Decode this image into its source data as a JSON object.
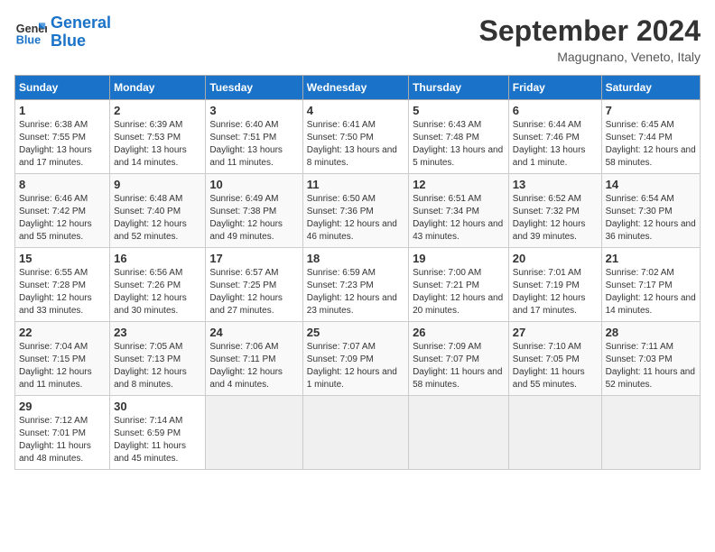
{
  "logo": {
    "line1": "General",
    "line2": "Blue"
  },
  "title": "September 2024",
  "subtitle": "Magugnano, Veneto, Italy",
  "weekdays": [
    "Sunday",
    "Monday",
    "Tuesday",
    "Wednesday",
    "Thursday",
    "Friday",
    "Saturday"
  ],
  "weeks": [
    [
      {
        "day": "1",
        "sunrise": "6:38 AM",
        "sunset": "7:55 PM",
        "daylight": "13 hours and 17 minutes."
      },
      {
        "day": "2",
        "sunrise": "6:39 AM",
        "sunset": "7:53 PM",
        "daylight": "13 hours and 14 minutes."
      },
      {
        "day": "3",
        "sunrise": "6:40 AM",
        "sunset": "7:51 PM",
        "daylight": "13 hours and 11 minutes."
      },
      {
        "day": "4",
        "sunrise": "6:41 AM",
        "sunset": "7:50 PM",
        "daylight": "13 hours and 8 minutes."
      },
      {
        "day": "5",
        "sunrise": "6:43 AM",
        "sunset": "7:48 PM",
        "daylight": "13 hours and 5 minutes."
      },
      {
        "day": "6",
        "sunrise": "6:44 AM",
        "sunset": "7:46 PM",
        "daylight": "13 hours and 1 minute."
      },
      {
        "day": "7",
        "sunrise": "6:45 AM",
        "sunset": "7:44 PM",
        "daylight": "12 hours and 58 minutes."
      }
    ],
    [
      {
        "day": "8",
        "sunrise": "6:46 AM",
        "sunset": "7:42 PM",
        "daylight": "12 hours and 55 minutes."
      },
      {
        "day": "9",
        "sunrise": "6:48 AM",
        "sunset": "7:40 PM",
        "daylight": "12 hours and 52 minutes."
      },
      {
        "day": "10",
        "sunrise": "6:49 AM",
        "sunset": "7:38 PM",
        "daylight": "12 hours and 49 minutes."
      },
      {
        "day": "11",
        "sunrise": "6:50 AM",
        "sunset": "7:36 PM",
        "daylight": "12 hours and 46 minutes."
      },
      {
        "day": "12",
        "sunrise": "6:51 AM",
        "sunset": "7:34 PM",
        "daylight": "12 hours and 43 minutes."
      },
      {
        "day": "13",
        "sunrise": "6:52 AM",
        "sunset": "7:32 PM",
        "daylight": "12 hours and 39 minutes."
      },
      {
        "day": "14",
        "sunrise": "6:54 AM",
        "sunset": "7:30 PM",
        "daylight": "12 hours and 36 minutes."
      }
    ],
    [
      {
        "day": "15",
        "sunrise": "6:55 AM",
        "sunset": "7:28 PM",
        "daylight": "12 hours and 33 minutes."
      },
      {
        "day": "16",
        "sunrise": "6:56 AM",
        "sunset": "7:26 PM",
        "daylight": "12 hours and 30 minutes."
      },
      {
        "day": "17",
        "sunrise": "6:57 AM",
        "sunset": "7:25 PM",
        "daylight": "12 hours and 27 minutes."
      },
      {
        "day": "18",
        "sunrise": "6:59 AM",
        "sunset": "7:23 PM",
        "daylight": "12 hours and 23 minutes."
      },
      {
        "day": "19",
        "sunrise": "7:00 AM",
        "sunset": "7:21 PM",
        "daylight": "12 hours and 20 minutes."
      },
      {
        "day": "20",
        "sunrise": "7:01 AM",
        "sunset": "7:19 PM",
        "daylight": "12 hours and 17 minutes."
      },
      {
        "day": "21",
        "sunrise": "7:02 AM",
        "sunset": "7:17 PM",
        "daylight": "12 hours and 14 minutes."
      }
    ],
    [
      {
        "day": "22",
        "sunrise": "7:04 AM",
        "sunset": "7:15 PM",
        "daylight": "12 hours and 11 minutes."
      },
      {
        "day": "23",
        "sunrise": "7:05 AM",
        "sunset": "7:13 PM",
        "daylight": "12 hours and 8 minutes."
      },
      {
        "day": "24",
        "sunrise": "7:06 AM",
        "sunset": "7:11 PM",
        "daylight": "12 hours and 4 minutes."
      },
      {
        "day": "25",
        "sunrise": "7:07 AM",
        "sunset": "7:09 PM",
        "daylight": "12 hours and 1 minute."
      },
      {
        "day": "26",
        "sunrise": "7:09 AM",
        "sunset": "7:07 PM",
        "daylight": "11 hours and 58 minutes."
      },
      {
        "day": "27",
        "sunrise": "7:10 AM",
        "sunset": "7:05 PM",
        "daylight": "11 hours and 55 minutes."
      },
      {
        "day": "28",
        "sunrise": "7:11 AM",
        "sunset": "7:03 PM",
        "daylight": "11 hours and 52 minutes."
      }
    ],
    [
      {
        "day": "29",
        "sunrise": "7:12 AM",
        "sunset": "7:01 PM",
        "daylight": "11 hours and 48 minutes."
      },
      {
        "day": "30",
        "sunrise": "7:14 AM",
        "sunset": "6:59 PM",
        "daylight": "11 hours and 45 minutes."
      },
      null,
      null,
      null,
      null,
      null
    ]
  ]
}
